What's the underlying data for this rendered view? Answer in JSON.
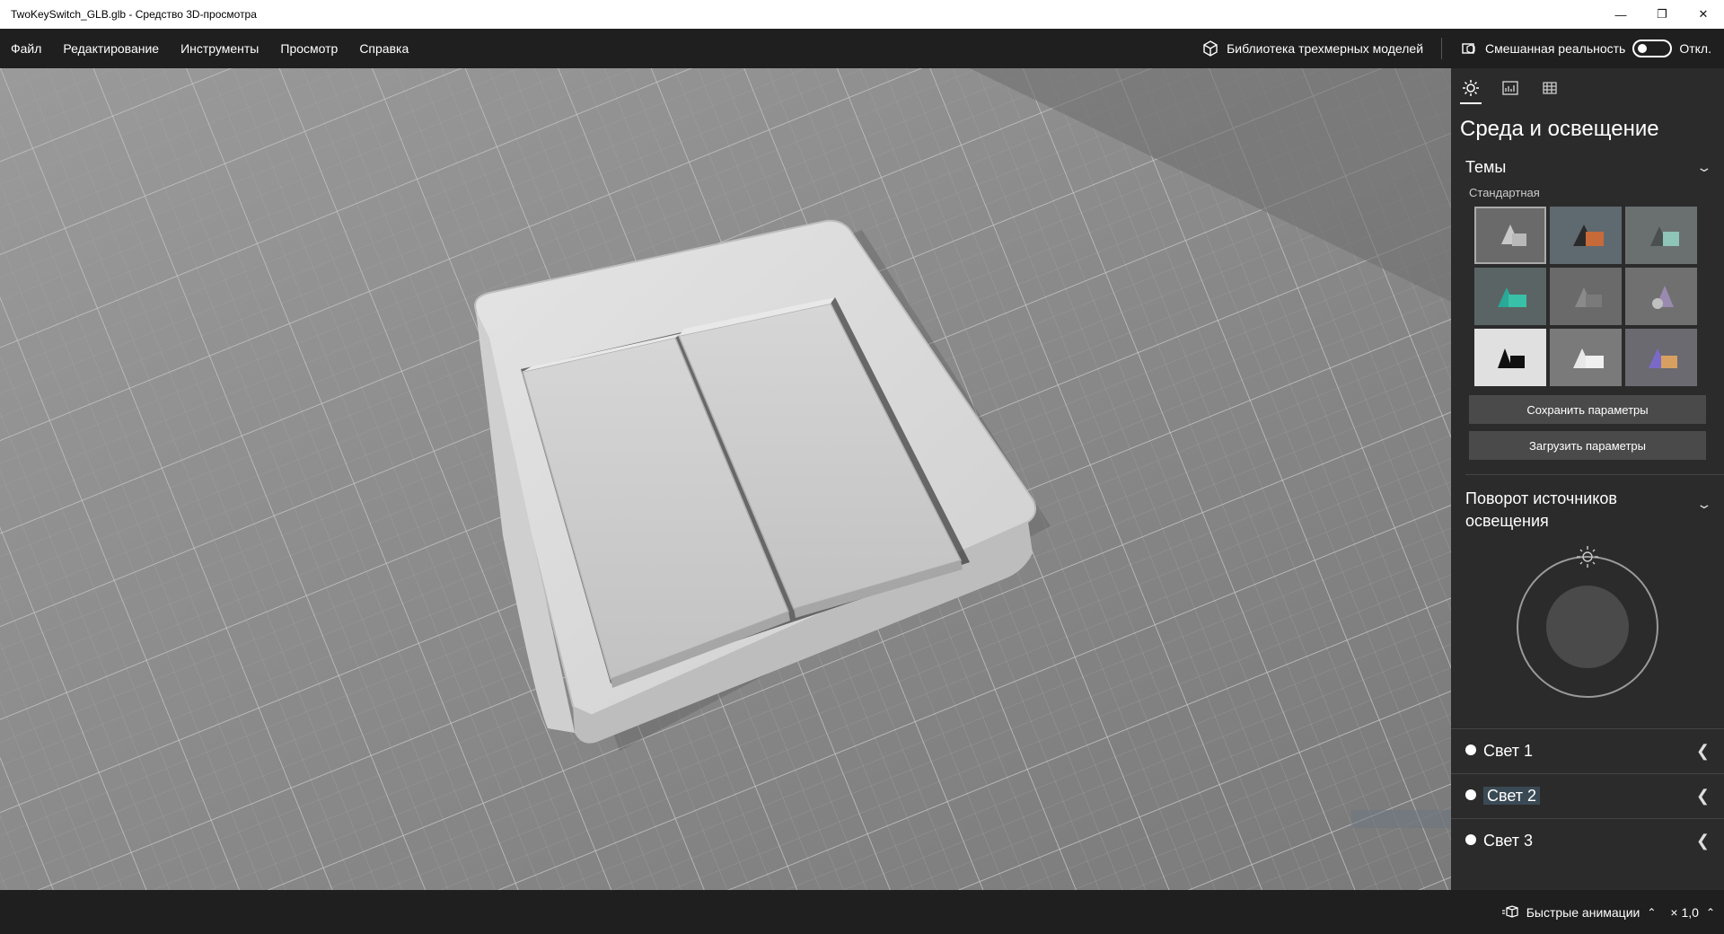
{
  "window": {
    "title": "TwoKeySwitch_GLB.glb - Средство 3D-просмотра",
    "minimize_icon": "minimize-icon",
    "maximize_icon": "restore-icon",
    "close_icon": "close-icon"
  },
  "menu": {
    "items": [
      "Файл",
      "Редактирование",
      "Инструменты",
      "Просмотр",
      "Справка"
    ],
    "library_label": "Библиотека трехмерных моделей",
    "mixed_reality_label": "Смешанная реальность",
    "mixed_reality_state": "Откл."
  },
  "panel": {
    "tabs": [
      "sun-icon",
      "stats-icon",
      "grid-icon"
    ],
    "title": "Среда и освещение",
    "themes_label": "Темы",
    "themes_sub": "Стандартная",
    "save_label": "Сохранить параметры",
    "load_label": "Загрузить параметры",
    "rotation_label": "Поворот источников освещения",
    "lights": [
      "Свет 1",
      "Свет 2",
      "Свет 3"
    ]
  },
  "bottom": {
    "animations_label": "Быстрые анимации",
    "speed": "× 1,0"
  },
  "colors": {
    "accent_bg": "#2b2b2b",
    "floor": "#8a8a8a"
  }
}
